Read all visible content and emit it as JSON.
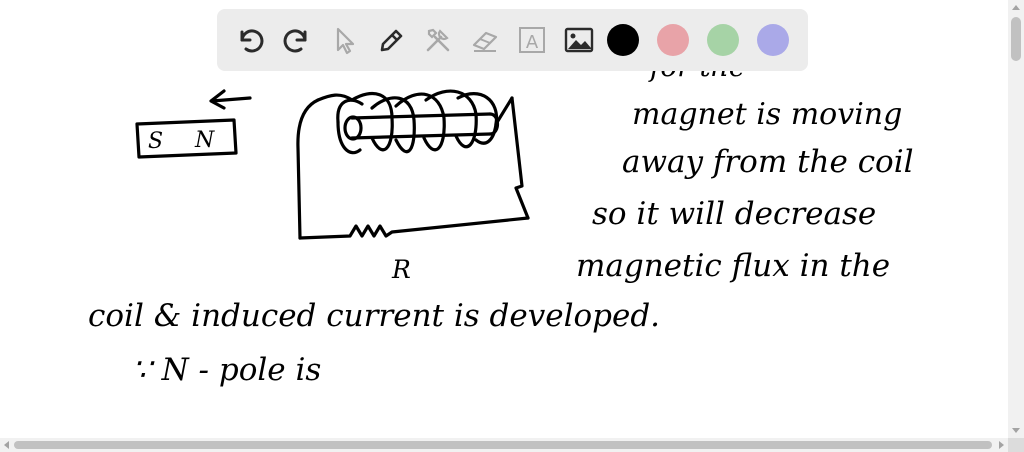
{
  "toolbar": {
    "tools": [
      {
        "name": "undo-icon",
        "enabled": true
      },
      {
        "name": "redo-icon",
        "enabled": true
      },
      {
        "name": "pointer-icon",
        "enabled": false
      },
      {
        "name": "pen-icon",
        "enabled": true
      },
      {
        "name": "tools-icon",
        "enabled": false
      },
      {
        "name": "eraser-icon",
        "enabled": false
      },
      {
        "name": "text-icon",
        "enabled": false,
        "glyph": "A"
      },
      {
        "name": "image-icon",
        "enabled": true
      }
    ],
    "colors": [
      "#000000",
      "#e8a3a8",
      "#a6d3a6",
      "#aaa9e8"
    ]
  },
  "notes": {
    "magnet": {
      "s_label": "S",
      "n_label": "N"
    },
    "resistor_label": "R",
    "lines": [
      "for the",
      "magnet is moving",
      "away from the coil",
      "so it will decrease",
      "magnetic flux in the",
      "coil & induced current is developed.",
      "∵ N - pole is"
    ]
  }
}
